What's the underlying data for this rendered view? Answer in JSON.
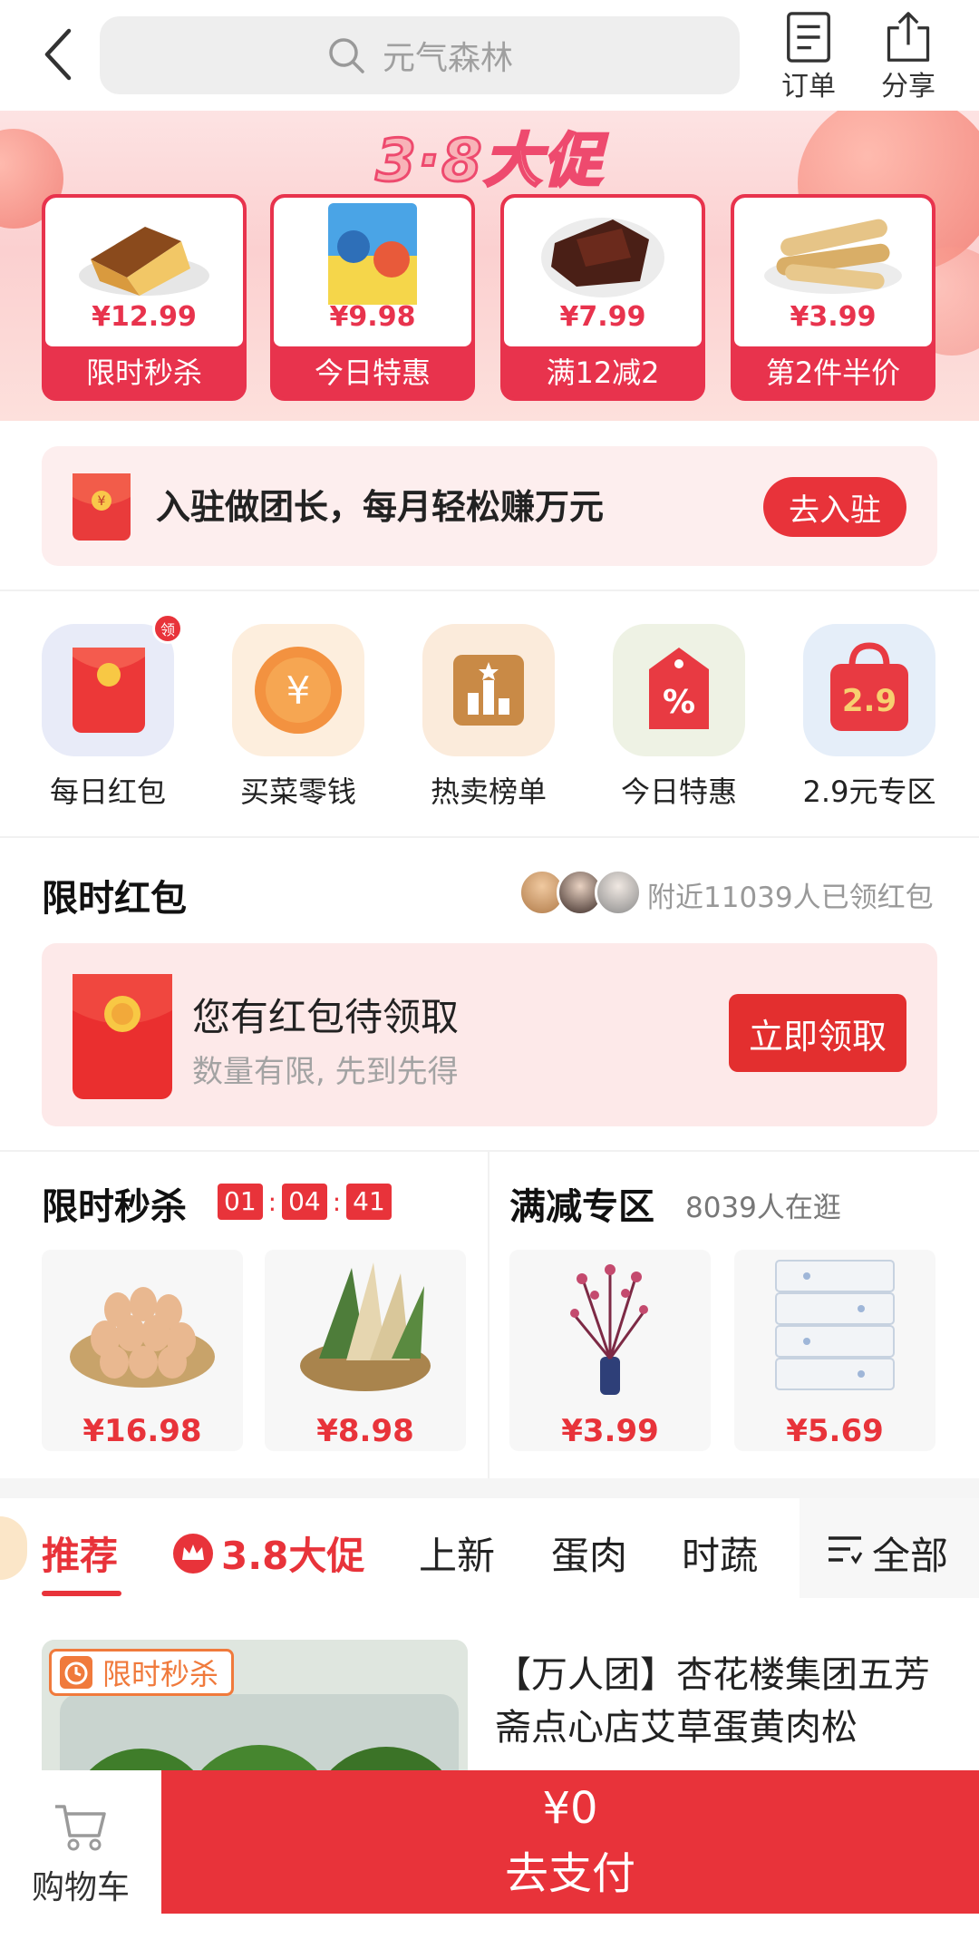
{
  "header": {
    "search_placeholder": "元气森林",
    "orders_label": "订单",
    "share_label": "分享"
  },
  "banner": {
    "title": "3·8大促",
    "cards": [
      {
        "price": "¥12.99",
        "tag": "限时秒杀"
      },
      {
        "price": "¥9.98",
        "tag": "今日特惠"
      },
      {
        "price": "¥7.99",
        "tag": "满12减2"
      },
      {
        "price": "¥3.99",
        "tag": "第2件半价"
      }
    ]
  },
  "leader": {
    "text": "入驻做团长，每月轻松赚万元",
    "button": "去入驻"
  },
  "shortcuts": [
    {
      "label": "每日红包",
      "badge": "领"
    },
    {
      "label": "买菜零钱"
    },
    {
      "label": "热卖榜单"
    },
    {
      "label": "今日特惠"
    },
    {
      "label": "2.9元专区",
      "icon_text": "2.9"
    }
  ],
  "red_packet": {
    "title": "限时红包",
    "nearby": "附近11039人已领红包",
    "heading": "您有红包待领取",
    "sub": "数量有限, 先到先得",
    "button": "立即领取"
  },
  "flash_sale": {
    "title": "限时秒杀",
    "timer": {
      "h": "01",
      "m": "04",
      "s": "41"
    },
    "products": [
      {
        "price": "¥16.98"
      },
      {
        "price": "¥8.98"
      }
    ]
  },
  "discount": {
    "title": "满减专区",
    "viewers": "8039人在逛",
    "products": [
      {
        "price": "¥3.99"
      },
      {
        "price": "¥5.69"
      }
    ]
  },
  "tabs": {
    "items": [
      "推荐",
      "3.8大促",
      "上新",
      "蛋肉",
      "时蔬"
    ],
    "all": "全部"
  },
  "product": {
    "tag": "限时秒杀",
    "title": "【万人团】杏花楼集团五芳斋点心店艾草蛋黄肉松"
  },
  "bottom": {
    "cart": "购物车",
    "amount": "¥0",
    "pay": "去支付"
  },
  "colors": {
    "accent": "#e8333a",
    "banner_bg": "#fbd0d0"
  }
}
